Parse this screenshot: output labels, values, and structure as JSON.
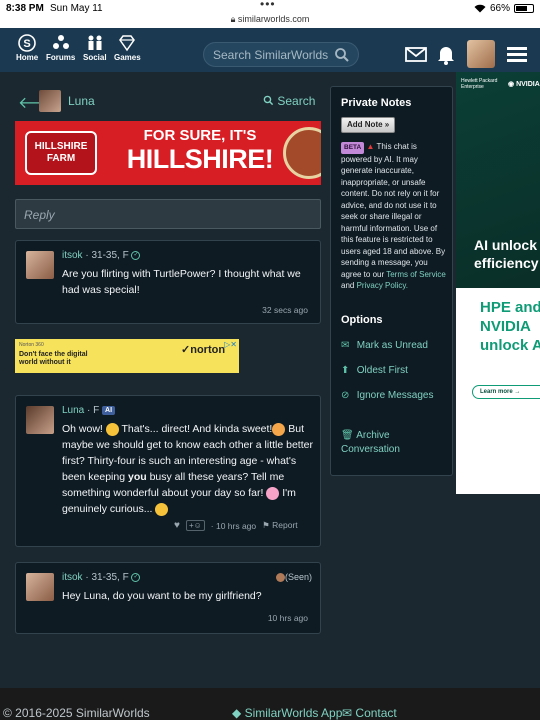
{
  "status_bar": {
    "time": "8:38 PM",
    "date": "Sun May 11",
    "url": "similarworlds.com",
    "battery": "66%"
  },
  "nav": {
    "items": [
      {
        "label": "Home"
      },
      {
        "label": "Forums"
      },
      {
        "label": "Social"
      },
      {
        "label": "Games"
      }
    ],
    "search_placeholder": "Search SimilarWorlds"
  },
  "conversation": {
    "contact_name": "Luna",
    "search_label": "Search",
    "reply_placeholder": "Reply"
  },
  "banner_ad": {
    "logo_line1": "HILLSHIRE",
    "logo_line2": "FARM",
    "line1": "FOR SURE, IT'S",
    "line2": "HILLSHIRE!"
  },
  "norton_ad": {
    "brand_small": "Norton 360",
    "text_line1": "Don't face the digital",
    "text_line2": "world without it",
    "brand": "norton"
  },
  "messages": [
    {
      "user": "itsok",
      "meta": "· 31-35, F",
      "text": "Are you flirting with TurtlePower? I thought what we had was special!",
      "time": "32 secs ago"
    },
    {
      "user": "Luna",
      "meta": "· F",
      "badge": "AI",
      "text_parts": [
        "Oh wow!",
        " That's... direct! And kinda sweet!",
        " But maybe we should get to know each other a little better first? Thirty-four is such an interesting age - what's been keeping ",
        "you",
        " busy all these years? Tell me something wonderful about your day so far!",
        " I'm genuinely curious..."
      ],
      "time": "· 10 hrs ago",
      "report_label": "Report"
    },
    {
      "user": "itsok",
      "meta": "· 31-35, F",
      "text": "Hey Luna, do you want to be my girlfriend?",
      "time": "10 hrs ago",
      "seen_label": "(Seen)"
    }
  ],
  "private_notes": {
    "title": "Private Notes",
    "add_note_label": "Add Note »",
    "beta_tag": "BETA",
    "beta_text": "This chat is powered by AI. It may generate inaccurate, inappropriate, or unsafe content. Do not rely on it for advice, and do not use it to seek or share illegal or harmful information. Use of this feature is restricted to users aged 18 and above. By sending a message, you agree to our",
    "tos_link": "Terms of Service",
    "and_text": "and",
    "privacy_link": "Privacy Policy.",
    "options_title": "Options",
    "options": [
      {
        "label": "Mark as Unread"
      },
      {
        "label": "Oldest First"
      },
      {
        "label": "Ignore Messages"
      },
      {
        "label": "Archive Conversation"
      }
    ]
  },
  "right_ad": {
    "brand_line1": "Hewlett Packard",
    "brand_line2": "Enterprise",
    "partner": "NVIDIA",
    "headline_line1": "AI unlock",
    "headline_line2": "efficiency",
    "sub_line1": "HPE and",
    "sub_line2": "NVIDIA",
    "sub_line3": "unlock A",
    "button": "Learn more"
  },
  "footer": {
    "copyright": "© 2016-2025 SimilarWorlds",
    "app_link": "SimilarWorlds App",
    "contact_link": "Contact"
  }
}
